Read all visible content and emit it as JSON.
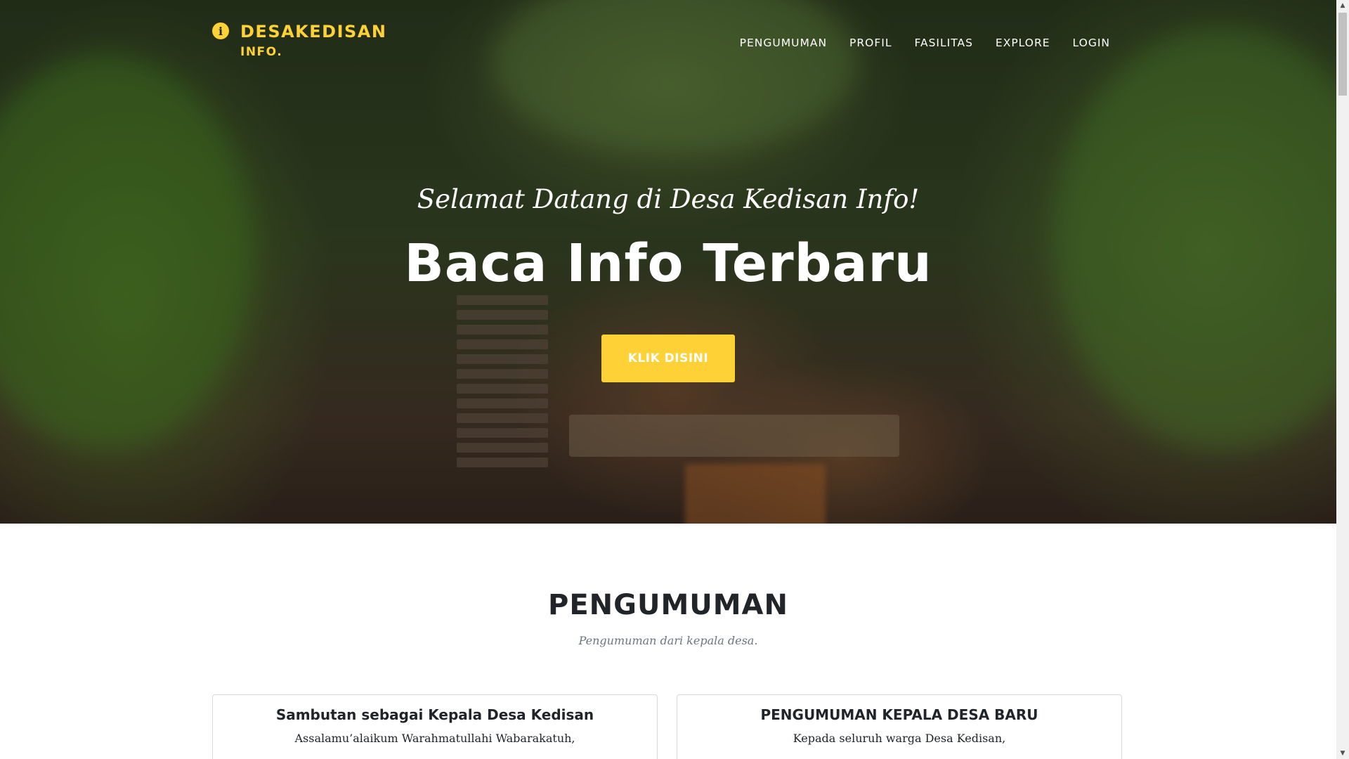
{
  "brand": {
    "icon": "info-circle-icon",
    "line1": "DESAKEDISAN",
    "line2": "INFO."
  },
  "nav": {
    "items": [
      "PENGUMUMAN",
      "PROFIL",
      "FASILITAS",
      "EXPLORE",
      "LOGIN"
    ]
  },
  "hero": {
    "subtitle": "Selamat Datang di Desa Kedisan Info!",
    "title": "Baca Info Terbaru",
    "button_label": "KLIK DISINI"
  },
  "section": {
    "title": "PENGUMUMAN",
    "subtitle": "Pengumuman dari kepala desa."
  },
  "cards": [
    {
      "title": "Sambutan sebagai Kepala Desa Kedisan",
      "text": "Assalamu’alaikum Warahmatullahi Wabarakatuh,"
    },
    {
      "title": "PENGUMUMAN KEPALA DESA BARU",
      "text": "Kepada seluruh warga Desa Kedisan,"
    }
  ],
  "colors": {
    "accent": "#fed136",
    "heading": "#212529",
    "muted": "#6c757d"
  }
}
